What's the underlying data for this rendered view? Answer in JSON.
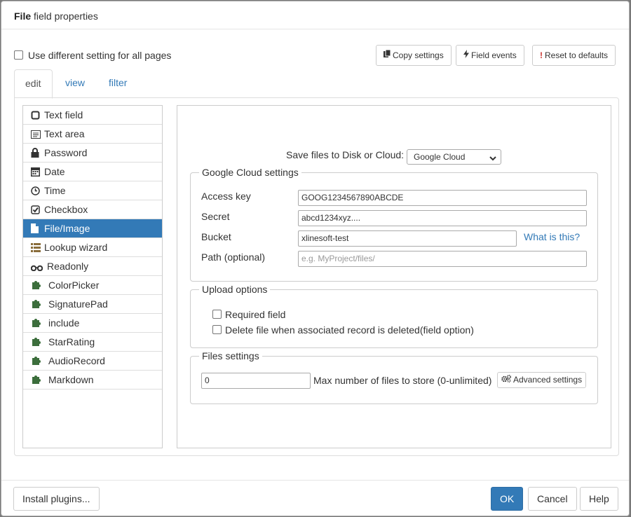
{
  "dialog": {
    "title_bold": "File",
    "title_rest": " field properties"
  },
  "toolbar": {
    "all_pages_label": "Use different setting for all pages",
    "copy_settings": "Copy settings",
    "field_events": "Field events",
    "reset_defaults": "Reset to defaults"
  },
  "tabs": [
    {
      "label": "edit",
      "active": true
    },
    {
      "label": "view",
      "active": false
    },
    {
      "label": "filter",
      "active": false
    }
  ],
  "sidebar": {
    "items": [
      {
        "label": "Text field",
        "icon": "square-outline-icon"
      },
      {
        "label": "Text area",
        "icon": "textarea-icon"
      },
      {
        "label": "Password",
        "icon": "lock-icon"
      },
      {
        "label": "Date",
        "icon": "calendar-icon"
      },
      {
        "label": "Time",
        "icon": "clock-icon"
      },
      {
        "label": "Checkbox",
        "icon": "check-square-icon"
      },
      {
        "label": "File/Image",
        "icon": "file-icon",
        "active": true
      },
      {
        "label": "Lookup wizard",
        "icon": "list-icon"
      },
      {
        "label": "Readonly",
        "icon": "glasses-icon"
      },
      {
        "label": "ColorPicker",
        "icon": "puzzle-icon"
      },
      {
        "label": "SignaturePad",
        "icon": "puzzle-icon"
      },
      {
        "label": "include",
        "icon": "puzzle-icon"
      },
      {
        "label": "StarRating",
        "icon": "puzzle-icon"
      },
      {
        "label": "AudioRecord",
        "icon": "puzzle-icon"
      },
      {
        "label": "Markdown",
        "icon": "puzzle-icon"
      }
    ]
  },
  "storage": {
    "label": "Save files to Disk or Cloud:",
    "selected": "Google Cloud"
  },
  "cloud": {
    "legend": "Google Cloud settings",
    "access_key_label": "Access key",
    "access_key_value": "GOOG1234567890ABCDE",
    "secret_label": "Secret",
    "secret_value": "abcd1234xyz....",
    "bucket_label": "Bucket",
    "bucket_value": "xlinesoft-test",
    "what_is_this": "What is this?",
    "path_label": "Path (optional)",
    "path_placeholder": "e.g. MyProject/files/"
  },
  "upload": {
    "legend": "Upload options",
    "required_label": "Required field",
    "delete_label": "Delete file when associated record is deleted(field option)"
  },
  "files": {
    "legend": "Files settings",
    "max_value": "0",
    "max_label": "Max number of files to store (0-unlimited)",
    "advanced": "Advanced settings"
  },
  "footer": {
    "install": "Install plugins...",
    "ok": "OK",
    "cancel": "Cancel",
    "help": "Help"
  }
}
